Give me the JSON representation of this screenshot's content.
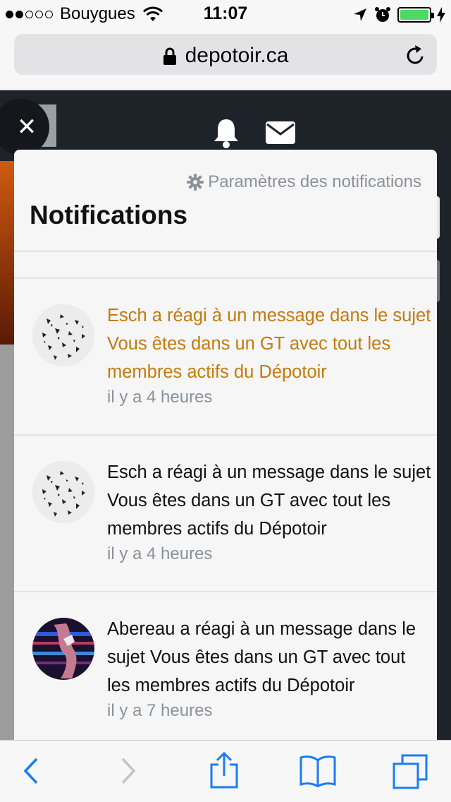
{
  "status_bar": {
    "carrier": "Bouygues",
    "time": "11:07",
    "signal_bars": 2,
    "battery_level": 1.0,
    "battery_color": "#4cd964"
  },
  "browser": {
    "url": "depotoir.ca"
  },
  "panel": {
    "settings_label": "Paramètres des notifications",
    "title": "Notifications"
  },
  "notifications": [
    {
      "text": "Esch a réagi à un message dans le sujet Vous êtes dans un GT avec tout les membres actifs du Dépotoir",
      "time": "il y a 4 heures",
      "unread": true
    },
    {
      "text": "Esch a réagi à un message dans le sujet Vous êtes dans un GT avec tout les membres actifs du Dépotoir",
      "time": "il y a 4 heures",
      "unread": false
    },
    {
      "text": "Abereau a réagi à un message dans le sujet Vous êtes dans un GT avec tout les membres actifs du Dépotoir",
      "time": "il y a 7 heures",
      "unread": false
    }
  ],
  "colors": {
    "unread_text": "#c47a0c",
    "meta_text": "#8a929a",
    "ios_blue": "#1a7cf5"
  }
}
